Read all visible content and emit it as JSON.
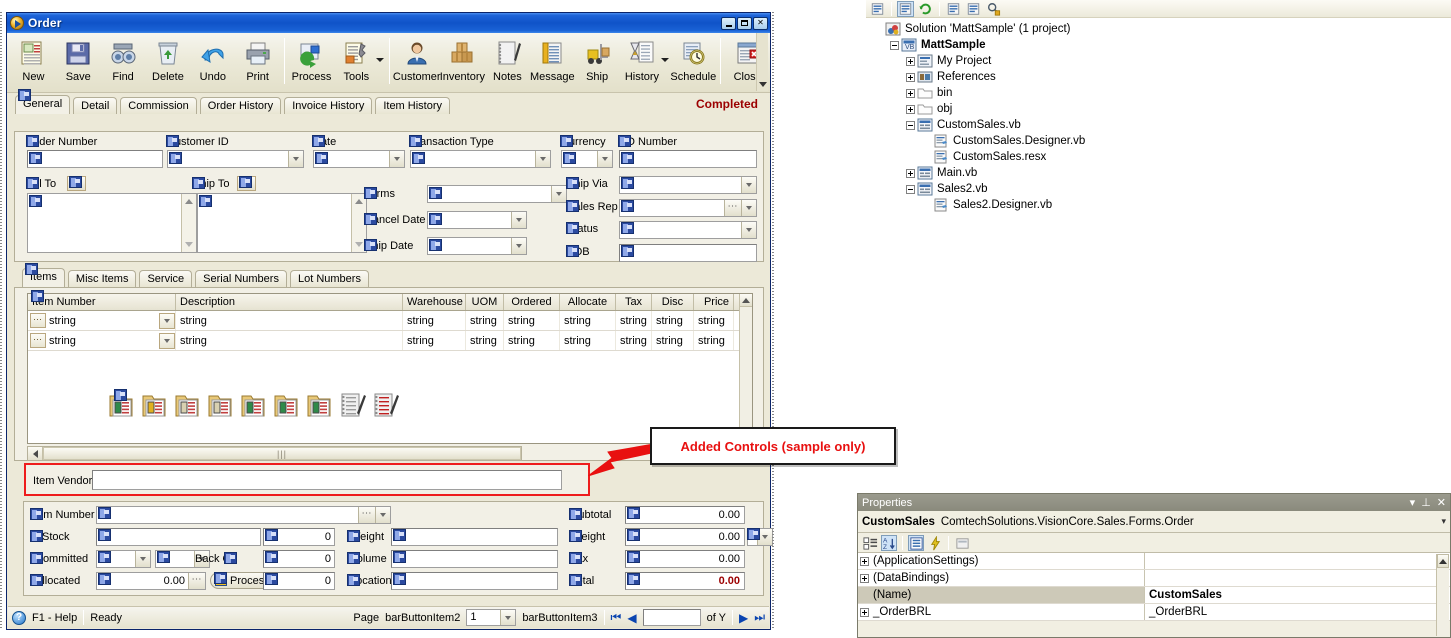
{
  "order_window": {
    "title": "Order",
    "title_icon": "order-ball-icon",
    "window_buttons": [
      "minimize",
      "maximize",
      "close"
    ],
    "toolbar": {
      "buttons": [
        {
          "label": "New",
          "icon": "new-document-icon",
          "dropdown": false
        },
        {
          "label": "Save",
          "icon": "floppy-disk-icon",
          "dropdown": false
        },
        {
          "label": "Find",
          "icon": "binoculars-icon",
          "dropdown": false
        },
        {
          "label": "Delete",
          "icon": "recycle-bin-icon",
          "dropdown": false
        },
        {
          "label": "Undo",
          "icon": "undo-arrow-icon",
          "dropdown": false
        },
        {
          "label": "Print",
          "icon": "printer-icon",
          "dropdown": false
        },
        {
          "label": "Process",
          "icon": "process-gear-icon",
          "dropdown": false
        },
        {
          "label": "Tools",
          "icon": "tools-wrench-icon",
          "dropdown": true
        },
        {
          "label": "Customer",
          "icon": "customer-person-icon",
          "dropdown": false
        },
        {
          "label": "Inventory",
          "icon": "inventory-boxes-icon",
          "dropdown": false
        },
        {
          "label": "Notes",
          "icon": "notes-pen-icon",
          "dropdown": false
        },
        {
          "label": "Message",
          "icon": "message-icon",
          "dropdown": false
        },
        {
          "label": "Ship",
          "icon": "forklift-icon",
          "dropdown": false
        },
        {
          "label": "History",
          "icon": "hourglass-history-icon",
          "dropdown": true
        },
        {
          "label": "Schedule",
          "icon": "schedule-clock-icon",
          "dropdown": false
        },
        {
          "label": "Close",
          "icon": "close-window-icon",
          "dropdown": false
        }
      ]
    },
    "main_tabs": [
      {
        "label": "General",
        "active": true
      },
      {
        "label": "Detail",
        "active": false
      },
      {
        "label": "Commission",
        "active": false
      },
      {
        "label": "Order History",
        "active": false
      },
      {
        "label": "Invoice History",
        "active": false
      },
      {
        "label": "Item History",
        "active": false
      }
    ],
    "status_label": "Completed",
    "general": {
      "order_number_label": "Order Number",
      "order_number_value": "",
      "customer_id_label": "Customer ID",
      "customer_id_value": "",
      "date_label": "Date",
      "date_value": "",
      "transaction_type_label": "Transaction Type",
      "transaction_type_value": "",
      "currency_label": "Currency",
      "currency_value": "",
      "po_number_label": "PO Number",
      "po_number_value": "",
      "bill_to_label": "Bill To",
      "bill_to_value": "",
      "ship_to_label": "Ship To",
      "ship_to_value": "",
      "terms_label": "Terms",
      "terms_value": "",
      "cancel_date_label": "Cancel Date",
      "cancel_date_value": "",
      "ship_date_label": "Ship Date",
      "ship_date_value": "",
      "ship_via_label": "Ship Via",
      "ship_via_value": "",
      "sales_rep_label": "Sales Rep",
      "sales_rep_value": "",
      "status_field_label": "Status",
      "status_field_value": "",
      "edb_label": "EDB",
      "edb_value": ""
    },
    "item_tabs": [
      {
        "label": "Items",
        "active": true
      },
      {
        "label": "Misc Items",
        "active": false
      },
      {
        "label": "Service",
        "active": false
      },
      {
        "label": "Serial Numbers",
        "active": false
      },
      {
        "label": "Lot Numbers",
        "active": false
      }
    ],
    "items_grid": {
      "columns": [
        "Item Number",
        "Description",
        "Warehouse",
        "UOM",
        "Ordered",
        "Allocate",
        "Tax",
        "Disc",
        "Price"
      ],
      "rows": [
        [
          "string",
          "string",
          "string",
          "string",
          "string",
          "string",
          "string",
          "string",
          "string"
        ],
        [
          "string",
          "string",
          "string",
          "string",
          "string",
          "string",
          "string",
          "string",
          "string"
        ]
      ]
    },
    "grid_doc_icons": [
      "kit-document-icon",
      "currency-document-icon",
      "note-document-icon",
      "note2-document-icon",
      "price-document-icon",
      "price2-document-icon",
      "price3-document-icon",
      "notepad-pen-icon",
      "notepad-red-pen-icon"
    ],
    "hscroll_thumb_glyph": "|||",
    "added_controls": {
      "item_vendor_label": "Item Vendor",
      "item_vendor_value": "",
      "callout_text": "Added Controls (sample only)",
      "highlight_color": "#ee1c1c"
    },
    "detail_panel": {
      "item_number_label": "Item Number",
      "item_number_value": "",
      "stock_label": "Stock",
      "stock_value": "",
      "stock_qty": "0",
      "committed_label": "Committed",
      "committed_value": "",
      "back_o_label": "Back O",
      "back_o_value": "",
      "committed_qty": "0",
      "allocated_label": "Allocated",
      "allocated_value": "0.00",
      "allocated_qty": "0",
      "process_button": "Process",
      "weight_label": "Weight",
      "weight_value": "",
      "volume_label": "Volume",
      "volume_value": "",
      "location_label": "Location",
      "location_value": "",
      "subtotal_label": "Subtotal",
      "subtotal_value": "0.00",
      "freight_label": "Freight",
      "freight_value": "0.00",
      "tax_label": "Tax",
      "tax_value": "0.00",
      "total_label": "Total",
      "total_value": "0.00",
      "total_color": "#9c0000"
    },
    "statusbar": {
      "help_label": "F1 - Help",
      "help_icon": "help-question-icon",
      "ready_label": "Ready",
      "page_label": "Page",
      "bar_button_item2": "barButtonItem2",
      "page_value": "1",
      "bar_button_item3": "barButtonItem3",
      "nav_first": "first-record-icon",
      "nav_prev": "previous-record-icon",
      "record_value": "",
      "of_label": "of Y",
      "nav_next": "next-record-icon",
      "nav_last": "last-record-icon"
    }
  },
  "solution_explorer": {
    "toolbar_icons": [
      "properties-page-icon",
      "show-all-files-icon",
      "refresh-icon",
      "view-code-icon",
      "view-designer-icon",
      "search-object-icon"
    ],
    "tree": [
      {
        "label": "Solution 'MattSample' (1 project)",
        "indent": 0,
        "expander": "none",
        "icon": "solution-icon",
        "bold": false
      },
      {
        "label": "MattSample",
        "indent": 1,
        "expander": "minus",
        "icon": "vb-project-icon",
        "bold": true
      },
      {
        "label": "My Project",
        "indent": 2,
        "expander": "plus",
        "icon": "my-project-icon",
        "bold": false
      },
      {
        "label": "References",
        "indent": 2,
        "expander": "plus",
        "icon": "references-icon",
        "bold": false
      },
      {
        "label": "bin",
        "indent": 2,
        "expander": "plus",
        "icon": "folder-icon",
        "bold": false
      },
      {
        "label": "obj",
        "indent": 2,
        "expander": "plus",
        "icon": "folder-icon",
        "bold": false
      },
      {
        "label": "CustomSales.vb",
        "indent": 2,
        "expander": "minus",
        "icon": "vb-form-icon",
        "bold": false
      },
      {
        "label": "CustomSales.Designer.vb",
        "indent": 3,
        "expander": "none",
        "icon": "vb-code-icon",
        "bold": false
      },
      {
        "label": "CustomSales.resx",
        "indent": 3,
        "expander": "none",
        "icon": "vb-code-icon",
        "bold": false
      },
      {
        "label": "Main.vb",
        "indent": 2,
        "expander": "plus",
        "icon": "vb-form-icon",
        "bold": false
      },
      {
        "label": "Sales2.vb",
        "indent": 2,
        "expander": "minus",
        "icon": "vb-form-icon",
        "bold": false
      },
      {
        "label": "Sales2.Designer.vb",
        "indent": 3,
        "expander": "none",
        "icon": "vb-code-icon",
        "bold": false
      }
    ]
  },
  "properties_pane": {
    "title": "Properties",
    "title_buttons": [
      "dropdown",
      "pin",
      "close"
    ],
    "object_name": "CustomSales",
    "object_type": "ComtechSolutions.VisionCore.Sales.Forms.Order",
    "toolbar_icons": [
      "categorized-icon",
      "alphabetical-icon",
      "properties-icon",
      "events-icon",
      "property-pages-icon"
    ],
    "rows": [
      {
        "name": "(ApplicationSettings)",
        "value": "",
        "expander": true,
        "selected": false,
        "bold_value": false
      },
      {
        "name": "(DataBindings)",
        "value": "",
        "expander": true,
        "selected": false,
        "bold_value": false
      },
      {
        "name": "(Name)",
        "value": "CustomSales",
        "expander": false,
        "selected": true,
        "bold_value": true
      },
      {
        "name": "_OrderBRL",
        "value": "_OrderBRL",
        "expander": true,
        "selected": false,
        "bold_value": false
      }
    ]
  }
}
